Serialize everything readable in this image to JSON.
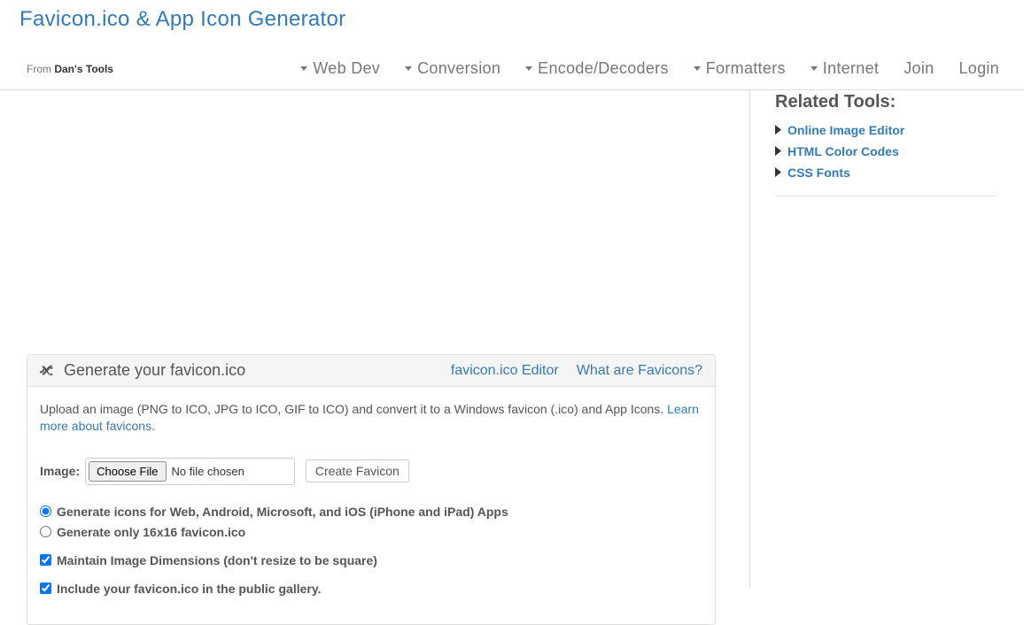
{
  "header": {
    "site_title": "Favicon.ico & App Icon Generator",
    "from_prefix": "From ",
    "from_name": "Dan's Tools"
  },
  "nav": {
    "items": [
      {
        "label": "Web Dev",
        "has_caret": true
      },
      {
        "label": "Conversion",
        "has_caret": true
      },
      {
        "label": "Encode/Decoders",
        "has_caret": true
      },
      {
        "label": "Formatters",
        "has_caret": true
      },
      {
        "label": "Internet",
        "has_caret": true
      },
      {
        "label": "Join",
        "has_caret": false
      },
      {
        "label": "Login",
        "has_caret": false
      }
    ]
  },
  "sidebar": {
    "heading": "Related Tools:",
    "items": [
      {
        "label": "Online Image Editor"
      },
      {
        "label": "HTML Color Codes"
      },
      {
        "label": "CSS Fonts"
      }
    ]
  },
  "panel": {
    "title": "Generate your favicon.ico",
    "links": [
      {
        "label": "favicon.ico Editor"
      },
      {
        "label": "What are Favicons?"
      }
    ],
    "upload_text": "Upload an image (PNG to ICO, JPG to ICO, GIF to ICO) and convert it to a Windows favicon (.ico) and App Icons. ",
    "learn_more": "Learn more about favicons",
    "period": ".",
    "image_label": "Image:",
    "file_button": "Choose File",
    "file_status": "No file chosen",
    "submit_button": "Create Favicon",
    "options": {
      "radio1": "Generate icons for Web, Android, Microsoft, and iOS (iPhone and iPad) Apps",
      "radio2": "Generate only 16x16 favicon.ico",
      "checkbox1": "Maintain Image Dimensions (don't resize to be square)",
      "checkbox2": "Include your favicon.ico in the public gallery."
    }
  }
}
